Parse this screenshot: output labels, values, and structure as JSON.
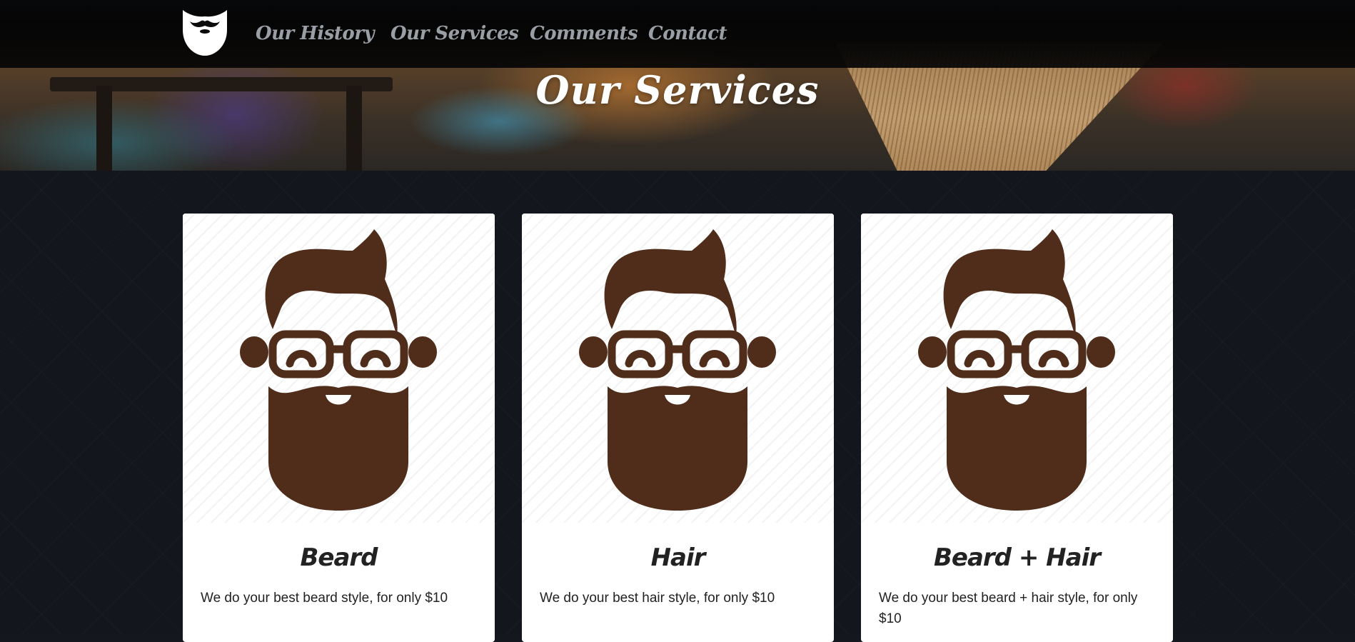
{
  "nav": {
    "items": [
      {
        "label": "Our History"
      },
      {
        "label": "Our Services"
      },
      {
        "label": "Comments"
      },
      {
        "label": "Contact"
      }
    ]
  },
  "hero": {
    "title": "Our Services"
  },
  "services": [
    {
      "title": "Beard",
      "text": "We do your best beard style, for only $10"
    },
    {
      "title": "Hair",
      "text": "We do your best hair style, for only $10"
    },
    {
      "title": "Beard + Hair",
      "text": "We do your best beard + hair style, for only $10"
    }
  ],
  "colors": {
    "accent_brown": "#4f2d1a",
    "nav_bg": "#050505",
    "page_bg": "#13161c",
    "card_bg": "#ffffff"
  },
  "icons": {
    "logo": "beard-shield-logo-icon",
    "card_image": "bearded-man-glasses-icon"
  }
}
